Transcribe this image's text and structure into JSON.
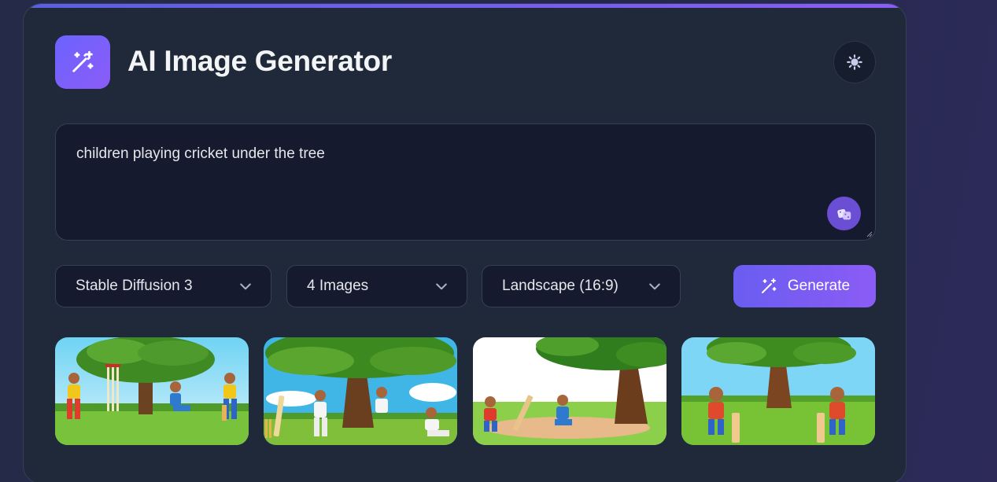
{
  "app": {
    "title": "AI Image Generator",
    "logo_icon": "magic-wand-icon",
    "theme_icon": "sun-icon"
  },
  "prompt": {
    "value": "children playing cricket under the tree",
    "random_icon": "dice-icon"
  },
  "controls": {
    "model": {
      "selected": "Stable Diffusion 3"
    },
    "count": {
      "selected": "4 Images"
    },
    "aspect": {
      "selected": "Landscape (16:9)"
    },
    "generate_label": "Generate",
    "generate_icon": "magic-wand-icon"
  },
  "gallery": {
    "images": [
      {
        "subject": "cricket-under-tree-1"
      },
      {
        "subject": "cricket-under-tree-2"
      },
      {
        "subject": "cricket-under-tree-3"
      },
      {
        "subject": "cricket-under-tree-4"
      }
    ]
  },
  "colors": {
    "accent": "#7c5cf4",
    "card_bg": "#1f2939",
    "input_bg": "#151a2e"
  }
}
